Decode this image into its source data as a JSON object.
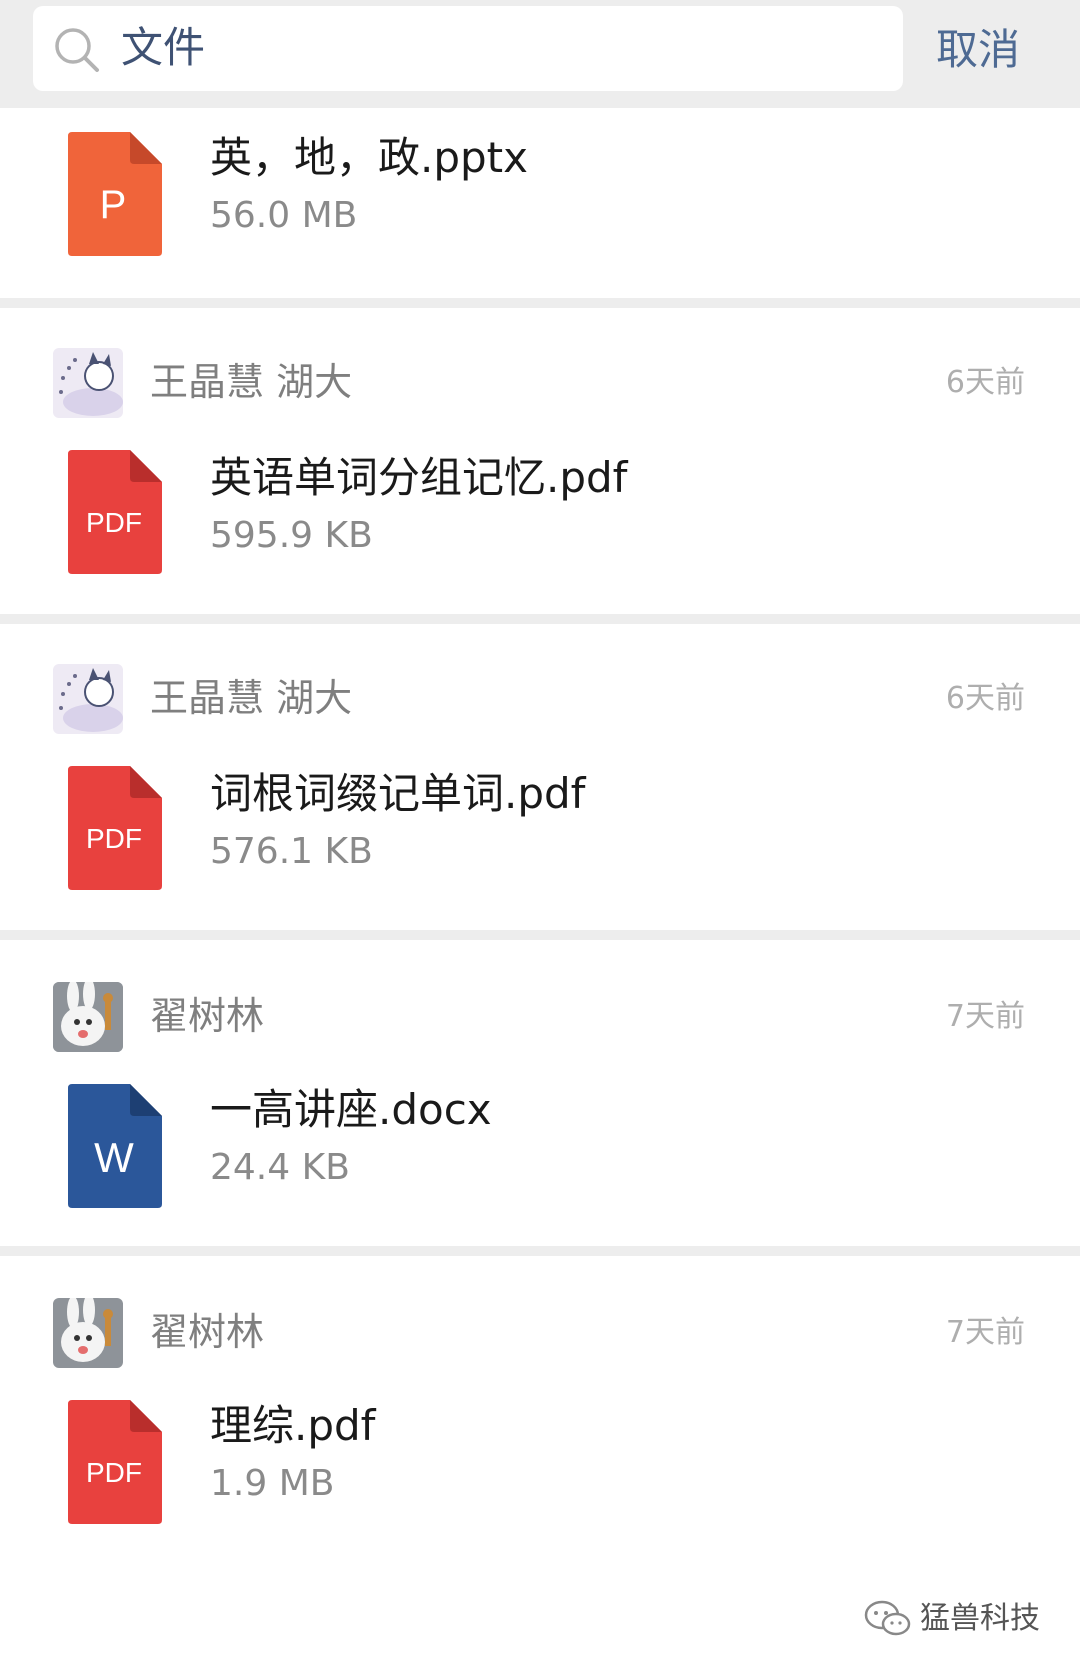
{
  "search": {
    "query": "文件",
    "cancel_label": "取消"
  },
  "results": [
    {
      "file_name": "英，地，政.pptx",
      "file_size": "56.0 MB",
      "file_type": "P",
      "icon": "ppt-file-icon",
      "color": "#f0643a"
    },
    {
      "sender": "王晶慧 湖大",
      "time": "6天前",
      "avatar": "cartoon-avatar",
      "file_name": "英语单词分组记忆.pdf",
      "file_size": "595.9 KB",
      "file_type": "PDF",
      "icon": "pdf-file-icon",
      "color": "#e8413e"
    },
    {
      "sender": "王晶慧 湖大",
      "time": "6天前",
      "avatar": "cartoon-avatar",
      "file_name": "词根词缀记单词.pdf",
      "file_size": "576.1 KB",
      "file_type": "PDF",
      "icon": "pdf-file-icon",
      "color": "#e8413e"
    },
    {
      "sender": "翟树林",
      "time": "7天前",
      "avatar": "bunny-avatar",
      "file_name": "一高讲座.docx",
      "file_size": "24.4 KB",
      "file_type": "W",
      "icon": "word-file-icon",
      "color": "#2b579a"
    },
    {
      "sender": "翟树林",
      "time": "7天前",
      "avatar": "bunny-avatar",
      "file_name": "理综.pdf",
      "file_size": "1.9 MB",
      "file_type": "PDF",
      "icon": "pdf-file-icon",
      "color": "#e8413e"
    }
  ],
  "watermark": {
    "text": "猛兽科技"
  }
}
